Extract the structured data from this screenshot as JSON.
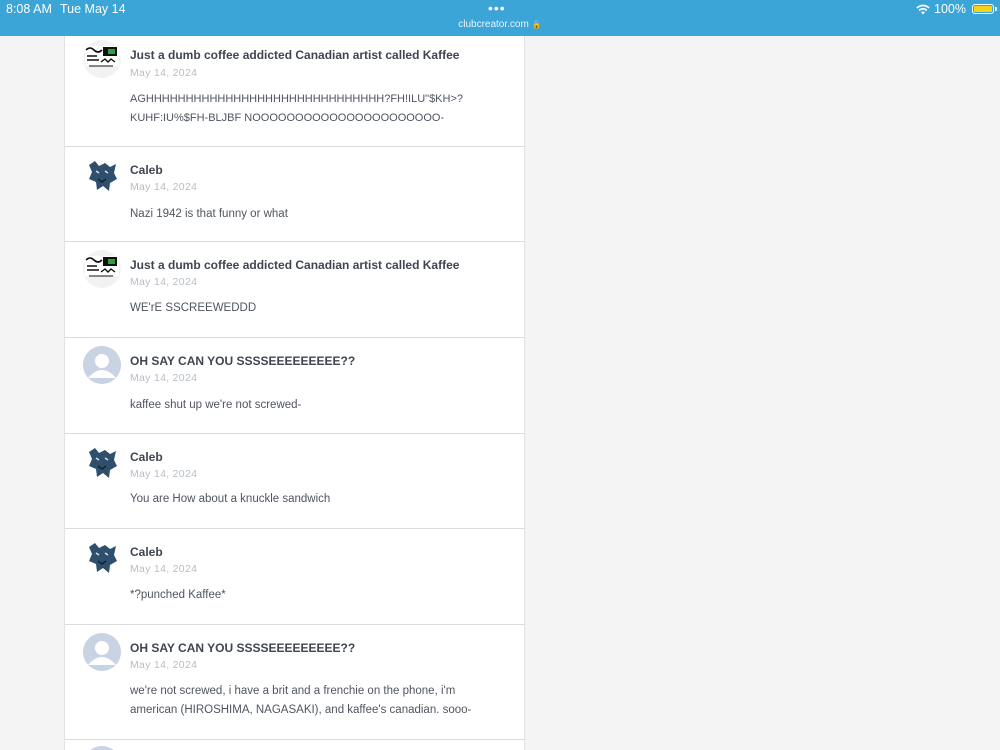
{
  "status": {
    "time": "8:08 AM",
    "date": "Tue May 14",
    "dots": "•••",
    "url": "clubcreator.com",
    "lock_icon": "lock-icon",
    "battery": "100%",
    "battery_level": 1.0,
    "battery_color": "#f5d31c",
    "bar_color": "#3aa5d6"
  },
  "posts": [
    {
      "author": "Just a dumb coffee addicted Canadian artist called Kaffee",
      "date": "May 14, 2024",
      "text": "AGHHHHHHHHHHHHHHHHHHHHHHHHHHHHHH?FH!ILU\"$KH>?KUHF:IU%$FH-BLJBF NOOOOOOOOOOOOOOOOOOOOOO-",
      "avatar": "kaffee-avatar"
    },
    {
      "author": "Caleb",
      "date": "May 14, 2024",
      "text": "Nazi 1942 is that funny or what",
      "avatar": "panther-avatar"
    },
    {
      "author": "Just a dumb coffee addicted Canadian artist called Kaffee",
      "date": "May 14, 2024",
      "text": "WE'rE SSCREEWEDDD",
      "avatar": "kaffee-avatar"
    },
    {
      "author": "OH SAY CAN YOU SSSSEEEEEEEEE??",
      "date": "May 14, 2024",
      "text": "kaffee shut up we're not screwed-",
      "avatar": "default-user-avatar"
    },
    {
      "author": "Caleb",
      "date": "May 14, 2024",
      "text": "You are How about a knuckle sandwich",
      "avatar": "panther-avatar"
    },
    {
      "author": "Caleb",
      "date": "May 14, 2024",
      "text": "*?punched Kaffee*",
      "avatar": "panther-avatar"
    },
    {
      "author": "OH SAY CAN YOU SSSSEEEEEEEEE??",
      "date": "May 14, 2024",
      "text": "we're not screwed, i have a brit and a frenchie on the phone, i'm american (HIROSHIMA, NAGASAKI), and kaffee's canadian. sooo-",
      "avatar": "default-user-avatar"
    }
  ]
}
